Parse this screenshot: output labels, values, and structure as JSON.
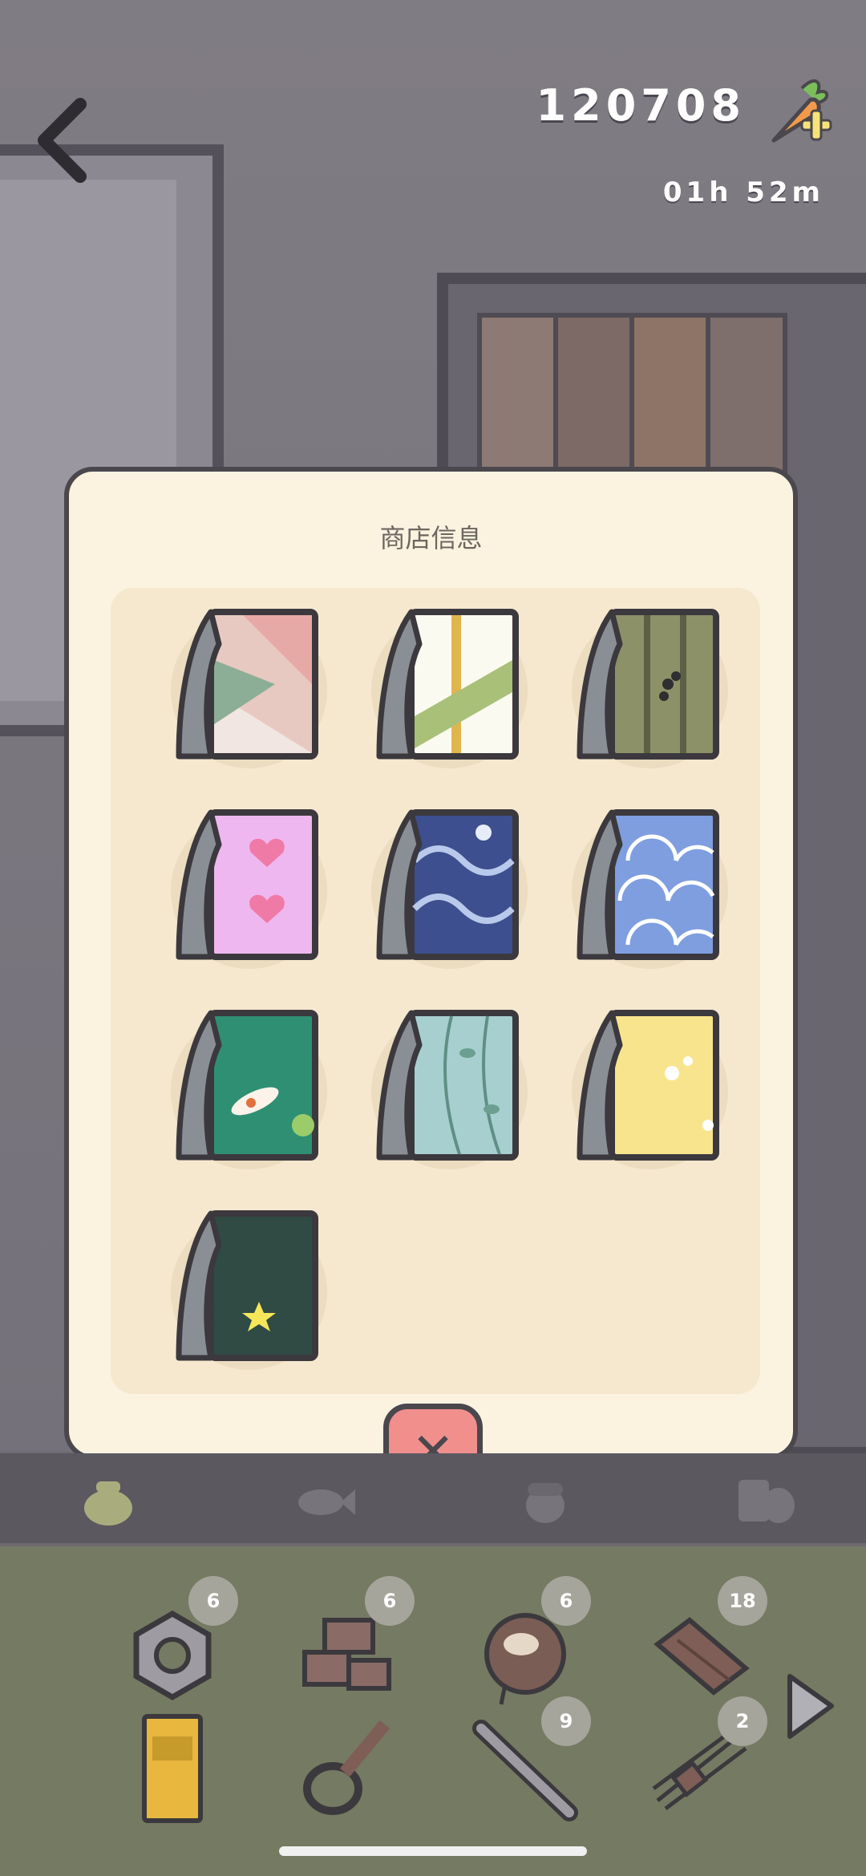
{
  "header": {
    "carrot_balance": "120708",
    "timer": "01h  52m",
    "back_icon": "chevron-left-icon",
    "carrot_icon": "carrot-plus-icon"
  },
  "modal": {
    "title": "商店信息",
    "close_icon": "close-icon",
    "items": [
      {
        "icon": "wallpaper-pink-geometric-icon"
      },
      {
        "icon": "wallpaper-bamboo-lattice-icon"
      },
      {
        "icon": "wallpaper-olive-bamboo-icon"
      },
      {
        "icon": "wallpaper-pink-hearts-icon"
      },
      {
        "icon": "wallpaper-blue-waves-icon"
      },
      {
        "icon": "wallpaper-seigaiha-icon"
      },
      {
        "icon": "wallpaper-koi-pond-icon"
      },
      {
        "icon": "wallpaper-leaf-vine-icon"
      },
      {
        "icon": "wallpaper-yellow-flower-icon"
      },
      {
        "icon": "wallpaper-dark-star-icon"
      }
    ]
  },
  "tabs": [
    {
      "icon": "bag-icon"
    },
    {
      "icon": "fish-icon"
    },
    {
      "icon": "acorn-icon"
    },
    {
      "icon": "food-icon"
    }
  ],
  "inventory": [
    {
      "icon": "hex-nut-icon",
      "count": "6"
    },
    {
      "icon": "bricks-icon",
      "count": "6"
    },
    {
      "icon": "coconut-icon",
      "count": "6"
    },
    {
      "icon": "plank-icon",
      "count": "18"
    },
    {
      "icon": "pocky-box-icon",
      "count": ""
    },
    {
      "icon": "rope-icon",
      "count": ""
    },
    {
      "icon": "bamboo-icon",
      "count": "9"
    },
    {
      "icon": "twig-bundle-icon",
      "count": "2"
    }
  ],
  "colors": {
    "modal_bg": "#fbf2e0",
    "close_button": "#f08f8c",
    "tray": "#757a62",
    "outline": "#4a474d"
  }
}
